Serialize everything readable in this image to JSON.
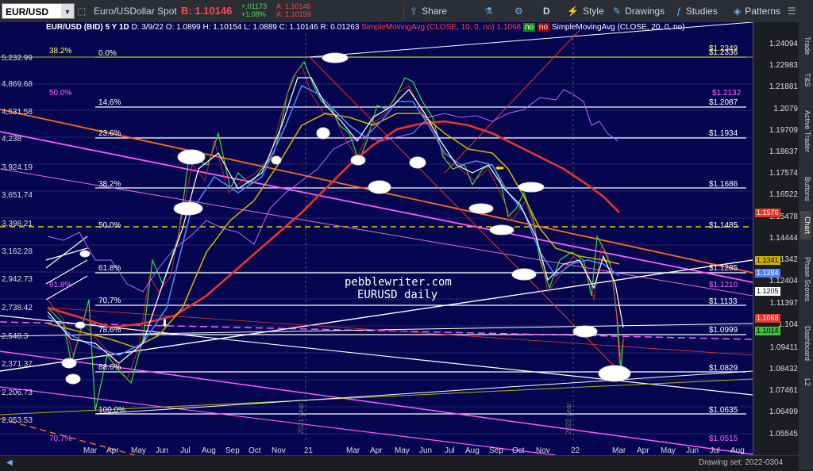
{
  "toolbar": {
    "symbol": "EUR/USD",
    "description": "Euro/USDollar Spot",
    "bid": "B: 1.10146",
    "change_abs": "+.01173",
    "change_pct": "+1.08%",
    "ask_1": "A: 1.10146",
    "ask_2": "A: 1.10159",
    "share": "Share",
    "period": "D",
    "style": "Style",
    "drawings": "Drawings",
    "studies": "Studies",
    "patterns": "Patterns"
  },
  "legend": {
    "header": "EUR/USD (BID) 5 Y 1D",
    "date": "D: 3/9/22",
    "open": "O: 1.0899",
    "high": "H: 1.10154",
    "low": "L: 1.0889",
    "close": "C: 1.10146",
    "range": "R: 0.01263",
    "sma10": "SimpleMovingAvg (CLOSE, 10, 0, no)",
    "sma10_val": "1.1068",
    "no1": "no",
    "no2": "no",
    "sma20": "SimpleMovingAvg (CLOSE, 20, 0, no)"
  },
  "watermark": {
    "line1": "pebblewriter.com",
    "line2": "EURUSD daily"
  },
  "left_axis": [
    "5,232.99",
    "4,869.68",
    "4,531.58",
    "4,238",
    "3,924.19",
    "3,651.74",
    "3,398.21",
    "3,162.28",
    "2,942.73",
    "2,738.42",
    "2,548.3",
    "2,371.37",
    "2,206.73",
    "2,053.53"
  ],
  "price_axis": [
    "1.24094",
    "1.22983",
    "1.21881",
    "1.2079",
    "1.19709",
    "1.18637",
    "1.17574",
    "1.16522",
    "1.15478",
    "1.14444",
    "1.1342",
    "1.12404",
    "1.11397",
    "1.104",
    "1.09411",
    "1.08432",
    "1.07461",
    "1.06499",
    "1.05545"
  ],
  "price_tags": [
    {
      "text": "1.1576",
      "bg": "#e8352b",
      "color": "#fff"
    },
    {
      "text": "1.1341",
      "bg": "#c9b100",
      "color": "#000"
    },
    {
      "text": "1.1284",
      "bg": "#4f7fff",
      "color": "#fff"
    },
    {
      "text": "1.1205",
      "bg": "#ffffff",
      "color": "#000"
    },
    {
      "text": "1.1068",
      "bg": "#e8352b",
      "color": "#fff"
    },
    {
      "text": "1.1014",
      "bg": "#3ac13a",
      "color": "#000"
    }
  ],
  "fib_levels": [
    {
      "pct": "0.0%",
      "price": "$1.2336"
    },
    {
      "pct": "14.6%",
      "price": "$1.2087"
    },
    {
      "pct": "23.6%",
      "price": "$1.1934"
    },
    {
      "pct": "38.2%",
      "price": "$1.1686"
    },
    {
      "pct": "50.0%",
      "price": "$1.1485"
    },
    {
      "pct": "61.8%",
      "price": "$1.1285"
    },
    {
      "pct": "70.7%",
      "price": "$1.1133"
    },
    {
      "pct": "78.6%",
      "price": "$1.0999"
    },
    {
      "pct": "88.6%",
      "price": "$1.0829"
    },
    {
      "pct": "100.0%",
      "price": "$1.0635"
    }
  ],
  "pink_levels": [
    {
      "pct": "38.2%",
      "price": "$1.2349"
    },
    {
      "pct": "50.0%",
      "price": "$1.2132"
    },
    {
      "pct": "61.8%",
      "price": "$1.1210"
    },
    {
      "pct": "70.7%",
      "price": "$1.0515"
    }
  ],
  "x_axis": [
    "Mar",
    "Apr",
    "May",
    "Jun",
    "Jul",
    "Aug",
    "Sep",
    "Oct",
    "Nov",
    "21",
    "Mar",
    "Apr",
    "May",
    "Jun",
    "Jul",
    "Aug",
    "Sep",
    "Oct",
    "Nov",
    "22",
    "Mar",
    "Apr",
    "May",
    "Jun",
    "Jul",
    "Aug"
  ],
  "year_markers": [
    "2021 year",
    "2022 year"
  ],
  "sidebar_tabs": [
    "Trade",
    "T&S",
    "Active Trader",
    "Buttons",
    "Chart",
    "Phase Scores",
    "Dashboard",
    "L2"
  ],
  "drawing_set": "Drawing set: 2022-0304",
  "colors": {
    "chart_bg": "#050550",
    "accent": "#5db1ff",
    "sma_red": "#e8352b",
    "sma_gold": "#c9b100",
    "sma_blue": "#4f7fff",
    "magenta": "#ff55ff"
  }
}
